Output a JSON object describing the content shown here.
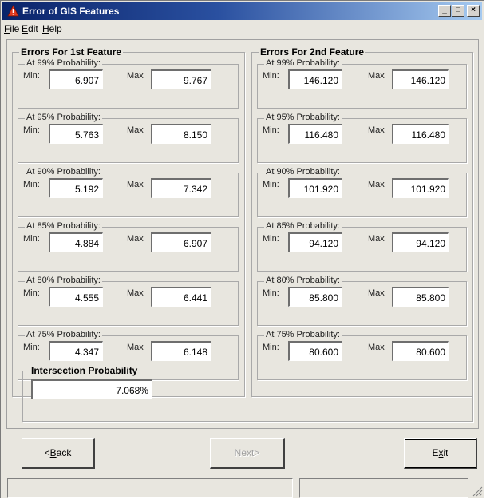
{
  "window": {
    "title": "Error of GIS Features"
  },
  "menu": {
    "file": {
      "mnemonic": "F",
      "rest": "ile"
    },
    "edit": {
      "mnemonic": "E",
      "rest": "dit"
    },
    "help": {
      "mnemonic": "H",
      "rest": "elp"
    }
  },
  "titlebar_buttons": {
    "minimize": "_",
    "maximize": "□",
    "close": "×"
  },
  "feature1": {
    "title": "Errors For 1st Feature",
    "groups": [
      {
        "label": "At 99% Probability:",
        "min_label": "Min:",
        "max_label": "Max",
        "min": "6.907",
        "max": "9.767"
      },
      {
        "label": "At 95% Probability:",
        "min_label": "Min:",
        "max_label": "Max",
        "min": "5.763",
        "max": "8.150"
      },
      {
        "label": "At 90% Probability:",
        "min_label": "Min:",
        "max_label": "Max",
        "min": "5.192",
        "max": "7.342"
      },
      {
        "label": "At 85% Probability:",
        "min_label": "Min:",
        "max_label": "Max",
        "min": "4.884",
        "max": "6.907"
      },
      {
        "label": "At 80% Probability:",
        "min_label": "Min:",
        "max_label": "Max",
        "min": "4.555",
        "max": "6.441"
      },
      {
        "label": "At 75% Probability:",
        "min_label": "Min:",
        "max_label": "Max",
        "min": "4.347",
        "max": "6.148"
      }
    ]
  },
  "feature2": {
    "title": "Errors For 2nd Feature",
    "groups": [
      {
        "label": "At 99% Probability:",
        "min_label": "Min:",
        "max_label": "Max",
        "min": "146.120",
        "max": "146.120"
      },
      {
        "label": "At 95% Probability:",
        "min_label": "Min:",
        "max_label": "Max",
        "min": "116.480",
        "max": "116.480"
      },
      {
        "label": "At 90% Probability:",
        "min_label": "Min:",
        "max_label": "Max",
        "min": "101.920",
        "max": "101.920"
      },
      {
        "label": "At 85% Probability:",
        "min_label": "Min:",
        "max_label": "Max",
        "min": "94.120",
        "max": "94.120"
      },
      {
        "label": "At 80% Probability:",
        "min_label": "Min:",
        "max_label": "Max",
        "min": "85.800",
        "max": "85.800"
      },
      {
        "label": "At 75% Probability:",
        "min_label": "Min:",
        "max_label": "Max",
        "min": "80.600",
        "max": "80.600"
      }
    ]
  },
  "intersection": {
    "title": "Intersection Probability",
    "value": "7.068%"
  },
  "buttons": {
    "back": {
      "prefix": "<",
      "mnemonic": "B",
      "rest": "ack"
    },
    "next": {
      "label": "Next>"
    },
    "exit": {
      "prefix": "E",
      "mnemonic": "x",
      "rest": "it"
    }
  },
  "colors": {
    "title_start": "#0a246a",
    "title_end": "#a6caf0",
    "face": "#e8e6df",
    "disabled_text": "#a0a0a0"
  }
}
